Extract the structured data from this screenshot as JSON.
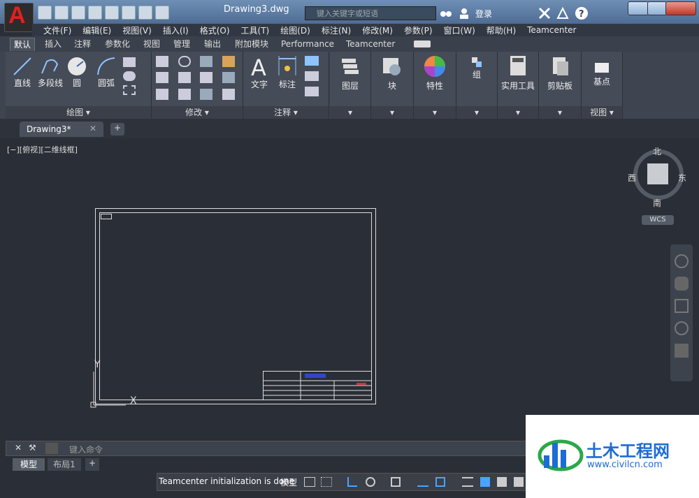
{
  "window": {
    "doc_title": "Drawing3.dwg",
    "search_placeholder": "键入关键字或短语",
    "login_label": "登录"
  },
  "menu": [
    "文件(F)",
    "编辑(E)",
    "视图(V)",
    "插入(I)",
    "格式(O)",
    "工具(T)",
    "绘图(D)",
    "标注(N)",
    "修改(M)",
    "参数(P)",
    "窗口(W)",
    "帮助(H)",
    "Teamcenter"
  ],
  "ribbon_tabs": [
    "默认",
    "插入",
    "注释",
    "参数化",
    "视图",
    "管理",
    "输出",
    "附加模块",
    "Performance",
    "Teamcenter"
  ],
  "panels": {
    "draw": {
      "label": "绘图 ▾",
      "tools": [
        "直线",
        "多段线",
        "圆",
        "圆弧"
      ]
    },
    "modify": {
      "label": "修改 ▾"
    },
    "annotate": {
      "label": "注释 ▾",
      "tools": [
        "文字",
        "标注"
      ]
    },
    "layers": {
      "label": "图层"
    },
    "block": {
      "label": "块"
    },
    "properties": {
      "label": "特性"
    },
    "group": {
      "label": "组"
    },
    "utilities": {
      "label": "实用工具"
    },
    "clipboard": {
      "label": "剪贴板"
    },
    "view": {
      "tool": "基点",
      "label": "视图 ▾"
    }
  },
  "doc_tab": {
    "label": "Drawing3*"
  },
  "viewport_label": "[−][俯视][二维线框]",
  "viewcube": {
    "north": "北",
    "south": "南",
    "east": "东",
    "west": "西",
    "wcs": "WCS"
  },
  "ucs": {
    "y": "Y",
    "x": "X"
  },
  "command": {
    "placeholder": "键入命令"
  },
  "layout_tabs": [
    "模型",
    "布局1",
    "+"
  ],
  "status": {
    "message": "Teamcenter initialization is done",
    "mode": "模型"
  },
  "watermark": {
    "brand": "土木工程网",
    "url": "www.civilcn.com"
  },
  "colors": {
    "accent": "#e02020",
    "canvas": "#2a2e36",
    "ribbon": "#454b57",
    "watermark_blue": "#1d6bd6",
    "watermark_green": "#2aa84a"
  }
}
